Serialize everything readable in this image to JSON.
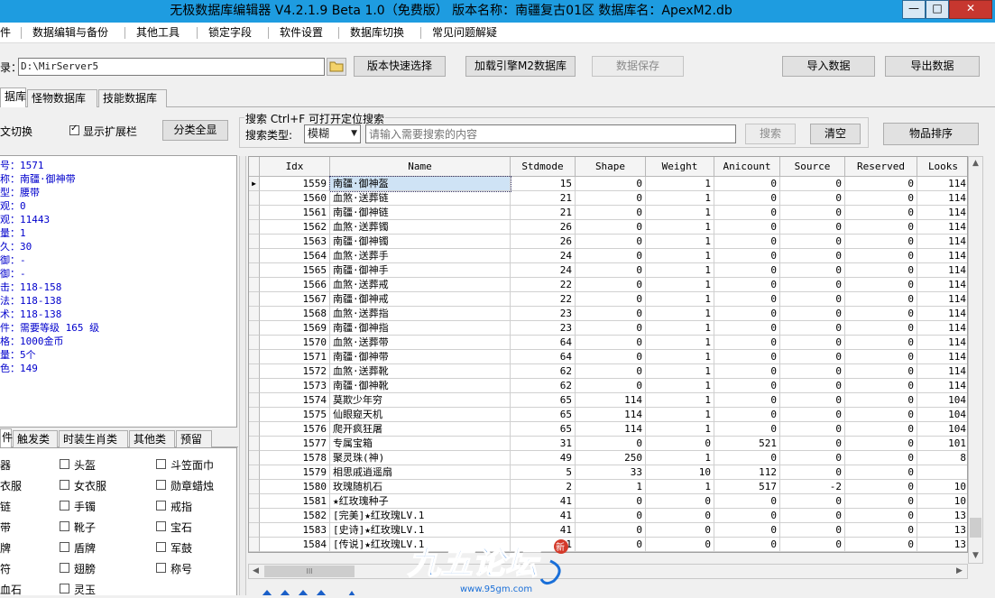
{
  "window": {
    "title": "无极数据库编辑器 V4.2.1.9   Beta 1.0（免费版）   版本名称：南疆复古01区   数据库名：ApexM2.db",
    "min": "—",
    "max": "□",
    "close": "✕"
  },
  "menu": [
    "件",
    "数据编辑与备份",
    "其他工具",
    "锁定字段",
    "软件设置",
    "数据库切换",
    "常见问题解疑"
  ],
  "toolbar": {
    "dir_label": "录：",
    "dir_value": "D:\\MirServer5",
    "quick_select": "版本快速选择",
    "load_engine": "加载引擎M2数据库",
    "save": "数据保存",
    "import": "导入数据",
    "export": "导出数据"
  },
  "tabs": [
    "据库",
    "怪物数据库",
    "技能数据库"
  ],
  "options": {
    "lang_switch": "文切换",
    "show_ext": "显示扩展栏",
    "show_ext_checked": true,
    "expand_all": "分类全显"
  },
  "search": {
    "caption": "搜索   Ctrl+F 可打开定位搜索",
    "type_label": "搜索类型:",
    "type_value": "模糊",
    "placeholder": "请输入需要搜索的内容",
    "search_btn": "搜索",
    "clear_btn": "清空",
    "sort_btn": "物品排序"
  },
  "info": [
    "号：1571",
    "称：南疆·御神带",
    "型：腰带",
    "观：0",
    "观：11443",
    "量：1",
    "久：30",
    "御：-",
    "御：-",
    "击：118-158",
    "法：118-138",
    "术：118-138",
    "件：需要等级 165 级",
    "格：1000金币",
    "量：5个",
    "色：149"
  ],
  "filter_tabs": [
    "件",
    "触发类",
    "时装生肖类",
    "其他类",
    "预留"
  ],
  "filters": [
    [
      "器",
      "头盔",
      "斗笠面巾"
    ],
    [
      "衣服",
      "女衣服",
      "勋章蜡烛"
    ],
    [
      "链",
      "手镯",
      "戒指"
    ],
    [
      "带",
      "靴子",
      "宝石"
    ],
    [
      "牌",
      "盾牌",
      "军鼓"
    ],
    [
      "符",
      "翅膀",
      "称号"
    ],
    [
      "血石",
      "灵玉",
      ""
    ]
  ],
  "grid": {
    "columns": [
      "Idx",
      "Name",
      "Stdmode",
      "Shape",
      "Weight",
      "Anicount",
      "Source",
      "Reserved",
      "Looks"
    ],
    "rows": [
      [
        "1559",
        "南疆·御神盔",
        "15",
        "0",
        "1",
        "0",
        "0",
        "0",
        "114"
      ],
      [
        "1560",
        "血煞·送葬链",
        "21",
        "0",
        "1",
        "0",
        "0",
        "0",
        "114"
      ],
      [
        "1561",
        "南疆·御神链",
        "21",
        "0",
        "1",
        "0",
        "0",
        "0",
        "114"
      ],
      [
        "1562",
        "血煞·送葬镯",
        "26",
        "0",
        "1",
        "0",
        "0",
        "0",
        "114"
      ],
      [
        "1563",
        "南疆·御神镯",
        "26",
        "0",
        "1",
        "0",
        "0",
        "0",
        "114"
      ],
      [
        "1564",
        "血煞·送葬手",
        "24",
        "0",
        "1",
        "0",
        "0",
        "0",
        "114"
      ],
      [
        "1565",
        "南疆·御神手",
        "24",
        "0",
        "1",
        "0",
        "0",
        "0",
        "114"
      ],
      [
        "1566",
        "血煞·送葬戒",
        "22",
        "0",
        "1",
        "0",
        "0",
        "0",
        "114"
      ],
      [
        "1567",
        "南疆·御神戒",
        "22",
        "0",
        "1",
        "0",
        "0",
        "0",
        "114"
      ],
      [
        "1568",
        "血煞·送葬指",
        "23",
        "0",
        "1",
        "0",
        "0",
        "0",
        "114"
      ],
      [
        "1569",
        "南疆·御神指",
        "23",
        "0",
        "1",
        "0",
        "0",
        "0",
        "114"
      ],
      [
        "1570",
        "血煞·送葬带",
        "64",
        "0",
        "1",
        "0",
        "0",
        "0",
        "114"
      ],
      [
        "1571",
        "南疆·御神带",
        "64",
        "0",
        "1",
        "0",
        "0",
        "0",
        "114"
      ],
      [
        "1572",
        "血煞·送葬靴",
        "62",
        "0",
        "1",
        "0",
        "0",
        "0",
        "114"
      ],
      [
        "1573",
        "南疆·御神靴",
        "62",
        "0",
        "1",
        "0",
        "0",
        "0",
        "114"
      ],
      [
        "1574",
        "莫欺少年穷",
        "65",
        "114",
        "1",
        "0",
        "0",
        "0",
        "104"
      ],
      [
        "1575",
        "仙眼窥天机",
        "65",
        "114",
        "1",
        "0",
        "0",
        "0",
        "104"
      ],
      [
        "1576",
        "爬开疯狂屠",
        "65",
        "114",
        "1",
        "0",
        "0",
        "0",
        "104"
      ],
      [
        "1577",
        "专属宝箱",
        "31",
        "0",
        "0",
        "521",
        "0",
        "0",
        "101"
      ],
      [
        "1578",
        "聚灵珠(神)",
        "49",
        "250",
        "1",
        "0",
        "0",
        "0",
        "8"
      ],
      [
        "1579",
        "相思戚逍遥扇",
        "5",
        "33",
        "10",
        "112",
        "0",
        "0",
        ""
      ],
      [
        "1580",
        "玫瑰随机石",
        "2",
        "1",
        "1",
        "517",
        "-2",
        "0",
        "10"
      ],
      [
        "1581",
        "★红玫瑰种子",
        "41",
        "0",
        "0",
        "0",
        "0",
        "0",
        "10"
      ],
      [
        "1582",
        "[完美]★红玫瑰LV.1",
        "41",
        "0",
        "0",
        "0",
        "0",
        "0",
        "13"
      ],
      [
        "1583",
        "[史诗]★红玫瑰LV.1",
        "41",
        "0",
        "0",
        "0",
        "0",
        "0",
        "13"
      ],
      [
        "1584",
        "[传说]★红玫瑰LV.1",
        "41",
        "0",
        "0",
        "0",
        "0",
        "0",
        "13"
      ]
    ]
  },
  "scrollbar": {
    "h_thumb": "III"
  },
  "watermark": {
    "text": "九五论坛",
    "badge": "新",
    "url": "www.95gm.com"
  },
  "colors": {
    "titlebar": "#1e9ce0",
    "info_text": "#0000cc",
    "watermark": "#1a6fd8"
  }
}
